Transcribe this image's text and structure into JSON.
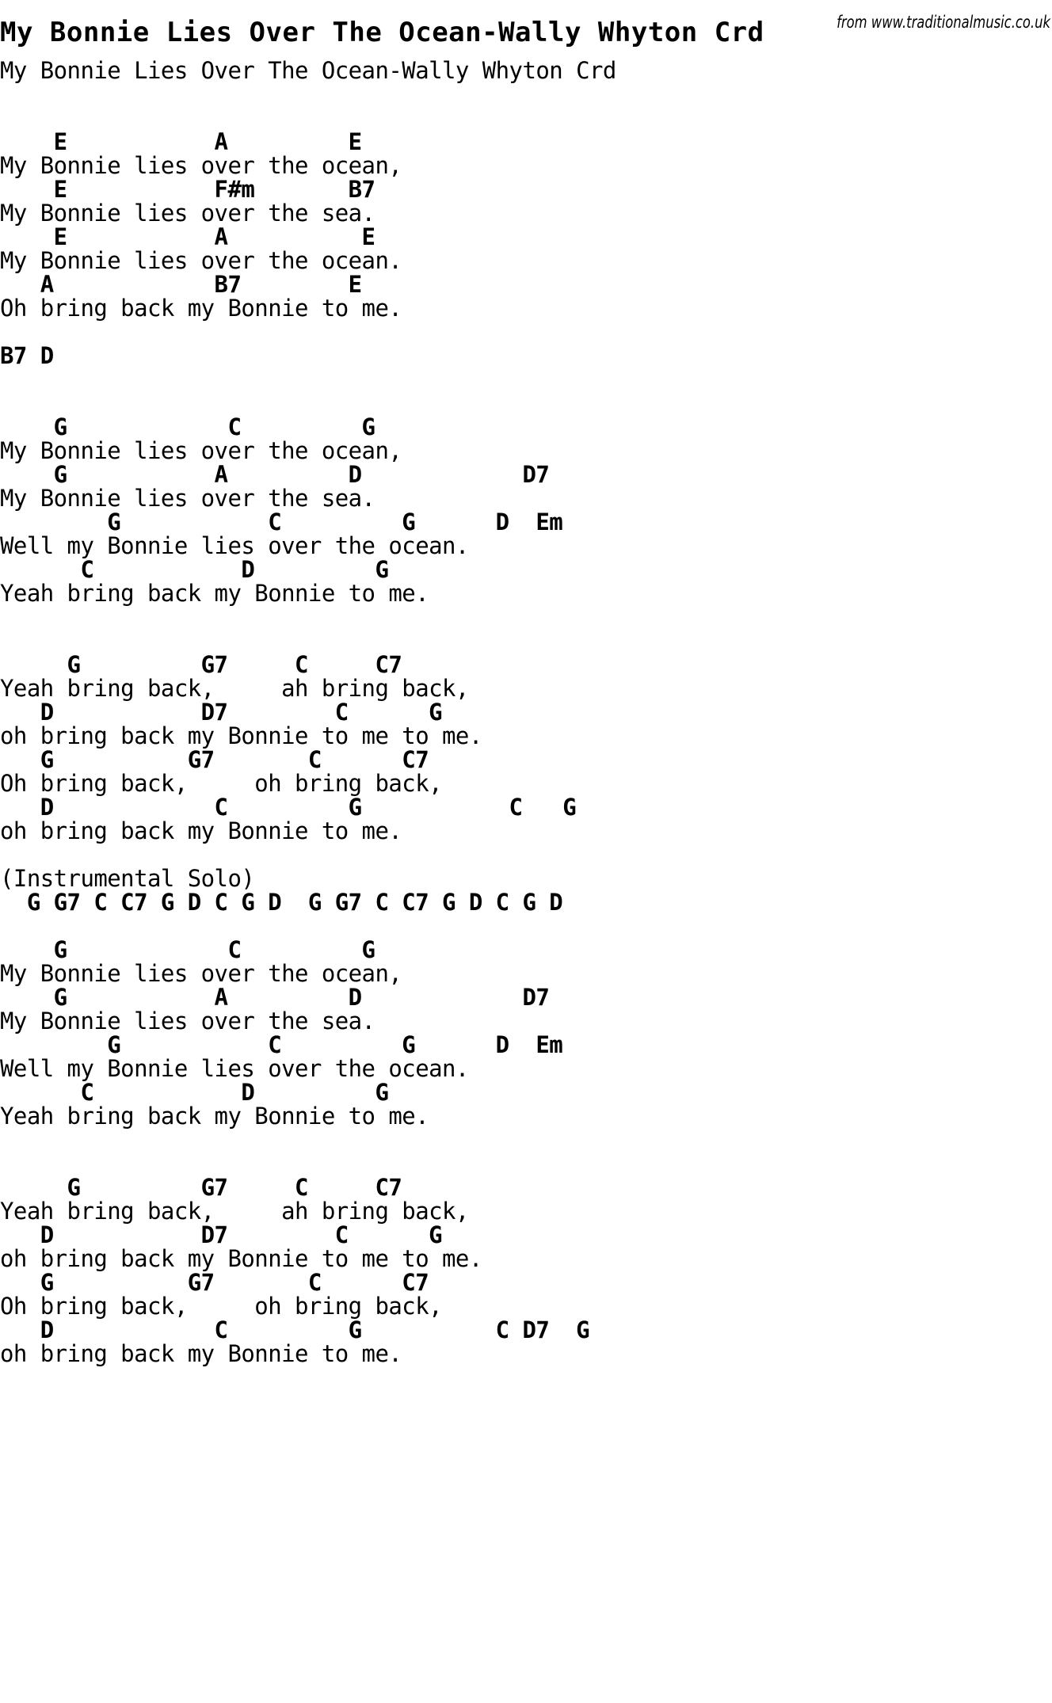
{
  "page": {
    "title": "My Bonnie Lies Over The Ocean-Wally Whyton Crd",
    "watermark": "from www.traditionalmusic.co.uk",
    "background_color": "#ffffff",
    "text_color": "#000000"
  },
  "song": {
    "subtitle": "My Bonnie Lies Over The Ocean-Wally Whyton Crd",
    "lines": [
      {
        "type": "blank",
        "text": ""
      },
      {
        "type": "lyric",
        "text": "My Bonnie Lies Over The Ocean-Wally Whyton Crd"
      },
      {
        "type": "blank",
        "text": ""
      },
      {
        "type": "blank",
        "text": ""
      },
      {
        "type": "chord",
        "text": "    E           A         E"
      },
      {
        "type": "lyric",
        "text": "My Bonnie lies over the ocean,"
      },
      {
        "type": "chord",
        "text": "    E           F#m       B7"
      },
      {
        "type": "lyric",
        "text": "My Bonnie lies over the sea."
      },
      {
        "type": "chord",
        "text": "    E           A          E"
      },
      {
        "type": "lyric",
        "text": "My Bonnie lies over the ocean."
      },
      {
        "type": "chord",
        "text": "   A            B7        E"
      },
      {
        "type": "lyric",
        "text": "Oh bring back my Bonnie to me."
      },
      {
        "type": "blank",
        "text": ""
      },
      {
        "type": "chord",
        "text": "B7 D"
      },
      {
        "type": "blank",
        "text": ""
      },
      {
        "type": "blank",
        "text": ""
      },
      {
        "type": "chord",
        "text": "    G            C         G"
      },
      {
        "type": "lyric",
        "text": "My Bonnie lies over the ocean,"
      },
      {
        "type": "chord",
        "text": "    G           A         D            D7"
      },
      {
        "type": "lyric",
        "text": "My Bonnie lies over the sea."
      },
      {
        "type": "chord",
        "text": "        G           C         G      D  Em"
      },
      {
        "type": "lyric",
        "text": "Well my Bonnie lies over the ocean."
      },
      {
        "type": "chord",
        "text": "      C           D         G"
      },
      {
        "type": "lyric",
        "text": "Yeah bring back my Bonnie to me."
      },
      {
        "type": "blank",
        "text": ""
      },
      {
        "type": "blank",
        "text": ""
      },
      {
        "type": "chord",
        "text": "     G         G7     C     C7"
      },
      {
        "type": "lyric",
        "text": "Yeah bring back,     ah bring back,"
      },
      {
        "type": "chord",
        "text": "   D           D7        C      G"
      },
      {
        "type": "lyric",
        "text": "oh bring back my Bonnie to me to me."
      },
      {
        "type": "chord",
        "text": "   G          G7       C      C7"
      },
      {
        "type": "lyric",
        "text": "Oh bring back,     oh bring back,"
      },
      {
        "type": "chord",
        "text": "   D            C         G           C   G"
      },
      {
        "type": "lyric",
        "text": "oh bring back my Bonnie to me."
      },
      {
        "type": "blank",
        "text": ""
      },
      {
        "type": "lyric",
        "text": "(Instrumental Solo)"
      },
      {
        "type": "chord",
        "text": "  G G7 C C7 G D C G D  G G7 C C7 G D C G D"
      },
      {
        "type": "blank",
        "text": ""
      },
      {
        "type": "chord",
        "text": "    G            C         G"
      },
      {
        "type": "lyric",
        "text": "My Bonnie lies over the ocean,"
      },
      {
        "type": "chord",
        "text": "    G           A         D            D7"
      },
      {
        "type": "lyric",
        "text": "My Bonnie lies over the sea."
      },
      {
        "type": "chord",
        "text": "        G           C         G      D  Em"
      },
      {
        "type": "lyric",
        "text": "Well my Bonnie lies over the ocean."
      },
      {
        "type": "chord",
        "text": "      C           D         G"
      },
      {
        "type": "lyric",
        "text": "Yeah bring back my Bonnie to me."
      },
      {
        "type": "blank",
        "text": ""
      },
      {
        "type": "blank",
        "text": ""
      },
      {
        "type": "chord",
        "text": "     G         G7     C     C7"
      },
      {
        "type": "lyric",
        "text": "Yeah bring back,     ah bring back,"
      },
      {
        "type": "chord",
        "text": "   D           D7        C      G"
      },
      {
        "type": "lyric",
        "text": "oh bring back my Bonnie to me to me."
      },
      {
        "type": "chord",
        "text": "   G          G7       C      C7"
      },
      {
        "type": "lyric",
        "text": "Oh bring back,     oh bring back,"
      },
      {
        "type": "chord",
        "text": "   D            C         G          C D7  G"
      },
      {
        "type": "lyric",
        "text": "oh bring back my Bonnie to me."
      }
    ]
  }
}
